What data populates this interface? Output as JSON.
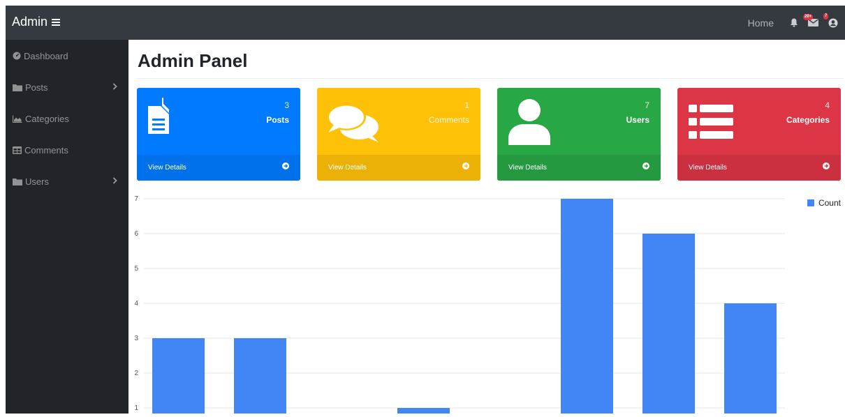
{
  "header": {
    "brand": "Admin",
    "nav_home": "Home",
    "messages_badge": "20+",
    "user_badge": "7"
  },
  "sidebar": {
    "items": [
      {
        "label": "Dashboard",
        "icon": "tachometer-icon"
      },
      {
        "label": "Posts",
        "icon": "folder-icon",
        "has_submenu": true
      },
      {
        "label": "Categories",
        "icon": "area-chart-icon"
      },
      {
        "label": "Comments",
        "icon": "table-icon"
      },
      {
        "label": "Users",
        "icon": "folder-icon",
        "has_submenu": true
      }
    ]
  },
  "main": {
    "title": "Admin Panel",
    "cards": [
      {
        "count": "3",
        "label": "Posts",
        "link": "View Details",
        "color": "#007bff",
        "icon": "file-icon"
      },
      {
        "count": "1",
        "label": "Comments",
        "link": "View Details",
        "color": "#ffc107",
        "icon": "comments-icon"
      },
      {
        "count": "7",
        "label": "Users",
        "link": "View Details",
        "color": "#28a745",
        "icon": "user-icon"
      },
      {
        "count": "4",
        "label": "Categories",
        "link": "View Details",
        "color": "#dc3545",
        "icon": "list-icon"
      }
    ]
  },
  "chart_data": {
    "type": "bar",
    "series": [
      {
        "name": "Count",
        "color": "#4285f4",
        "values": [
          3,
          3,
          0,
          1,
          0,
          7,
          6,
          4
        ]
      }
    ],
    "y_ticks": [
      "1",
      "2",
      "3",
      "4",
      "5",
      "6",
      "7"
    ],
    "grid": true,
    "legend_position": "top-right"
  }
}
